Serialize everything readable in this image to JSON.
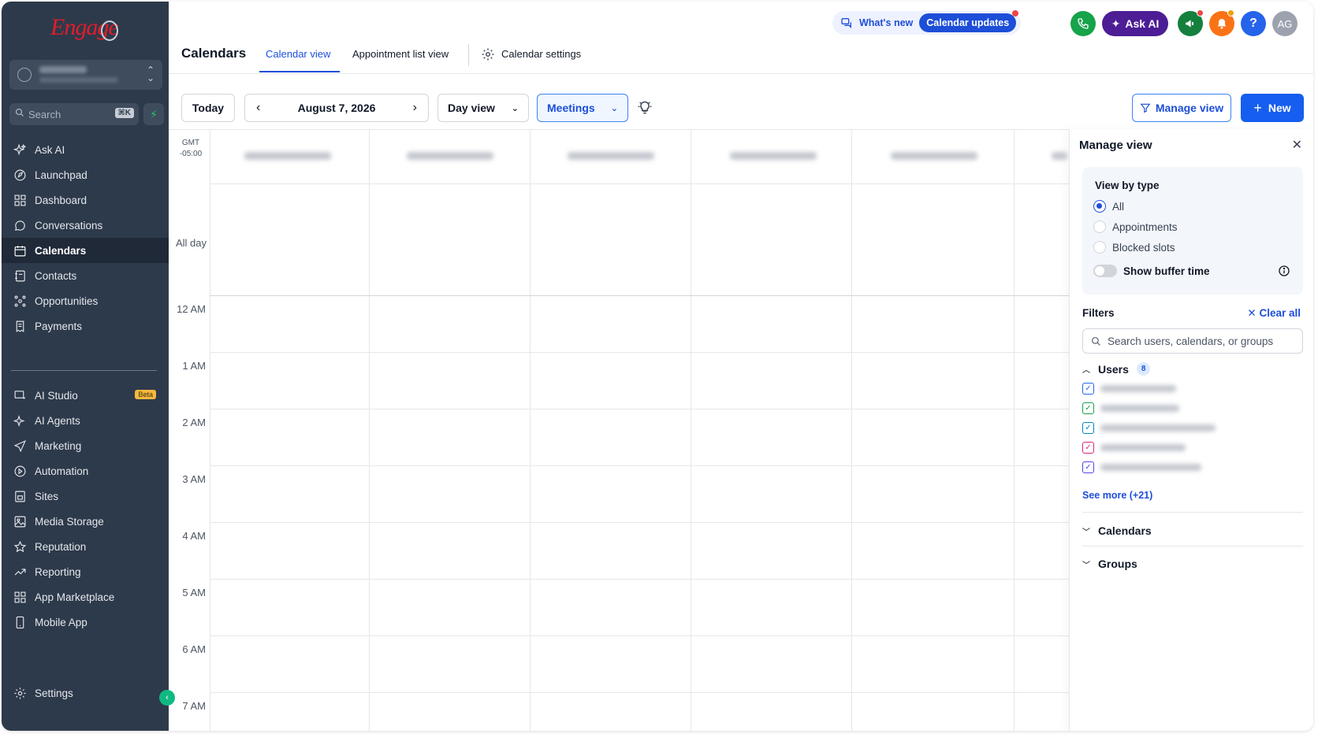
{
  "sidebar": {
    "logo": "Engage",
    "search": {
      "placeholder": "Search",
      "shortcut": "⌘K"
    },
    "items": [
      {
        "label": "Ask AI",
        "icon": "sparkle-icon"
      },
      {
        "label": "Launchpad",
        "icon": "rocket-icon"
      },
      {
        "label": "Dashboard",
        "icon": "grid-icon"
      },
      {
        "label": "Conversations",
        "icon": "chat-icon"
      },
      {
        "label": "Calendars",
        "icon": "calendar-icon",
        "active": true
      },
      {
        "label": "Contacts",
        "icon": "contacts-icon"
      },
      {
        "label": "Opportunities",
        "icon": "network-icon"
      },
      {
        "label": "Payments",
        "icon": "receipt-icon"
      }
    ],
    "items2": [
      {
        "label": "AI Studio",
        "icon": "ai-studio-icon",
        "badge": "Beta"
      },
      {
        "label": "AI Agents",
        "icon": "sparkle-icon"
      },
      {
        "label": "Marketing",
        "icon": "send-icon"
      },
      {
        "label": "Automation",
        "icon": "automation-icon"
      },
      {
        "label": "Sites",
        "icon": "sites-icon"
      },
      {
        "label": "Media Storage",
        "icon": "image-icon"
      },
      {
        "label": "Reputation",
        "icon": "star-icon"
      },
      {
        "label": "Reporting",
        "icon": "trend-icon"
      },
      {
        "label": "App Marketplace",
        "icon": "apps-icon"
      },
      {
        "label": "Mobile App",
        "icon": "phone-device-icon"
      }
    ],
    "settings": "Settings"
  },
  "header": {
    "whats_new": "What's new",
    "calendar_updates": "Calendar updates",
    "ask_ai": "Ask AI",
    "help": "?",
    "user_initials": "AG",
    "page_title": "Calendars",
    "tabs": [
      "Calendar view",
      "Appointment list view",
      "Calendar settings"
    ],
    "active_tab": "Calendar view"
  },
  "toolbar": {
    "today": "Today",
    "date": "August 7, 2026",
    "view": "Day view",
    "filter": "Meetings",
    "manage_view": "Manage view",
    "new": "New"
  },
  "calendar": {
    "timezone_line1": "GMT",
    "timezone_line2": "-05:00",
    "all_day": "All day",
    "hours": [
      "12 AM",
      "1 AM",
      "2 AM",
      "3 AM",
      "4 AM",
      "5 AM",
      "6 AM",
      "7 AM"
    ]
  },
  "manage_view": {
    "title": "Manage view",
    "view_by_type": "View by type",
    "types": [
      "All",
      "Appointments",
      "Blocked slots"
    ],
    "selected_type": "All",
    "show_buffer_time": "Show buffer time",
    "filters": "Filters",
    "clear_all": "Clear all",
    "search_placeholder": "Search users, calendars, or groups",
    "users_label": "Users",
    "users_count": "8",
    "user_checkbox_colors": [
      "#2563eb",
      "#16a34a",
      "#0284c7",
      "#db2777",
      "#4f46e5"
    ],
    "see_more": "See more (+21)",
    "calendars_label": "Calendars",
    "groups_label": "Groups"
  },
  "colors": {
    "sidebar_bg": "#2d3a4b",
    "accent": "#155eef",
    "brand_red": "#e11d2a"
  }
}
